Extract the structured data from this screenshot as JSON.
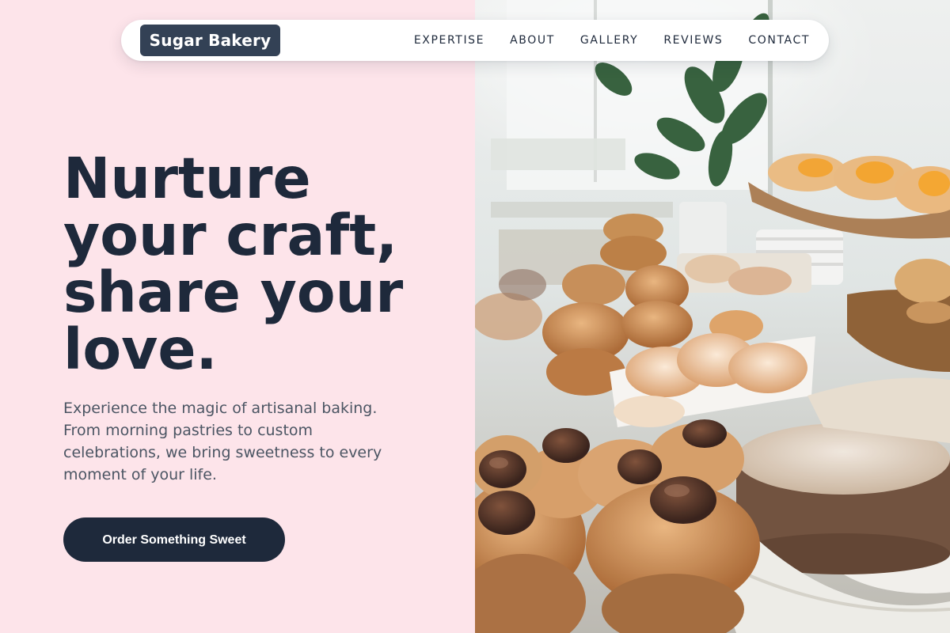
{
  "navbar": {
    "logo": "Sugar Bakery",
    "links": [
      "EXPERTISE",
      "ABOUT",
      "GALLERY",
      "REVIEWS",
      "CONTACT"
    ]
  },
  "hero": {
    "title_lines": [
      "Nurture",
      "your craft,",
      "share your",
      "love."
    ],
    "text_lines": [
      "Experience the magic of artisanal baking.",
      "From morning pastries to custom",
      "celebrations, we bring sweetness to every",
      "moment of your life."
    ],
    "cta_label": "Order Something Sweet"
  },
  "colors": {
    "left_background": "#fde4ea",
    "dark_navy": "#1e293b",
    "logo_background": "#334155",
    "body_text": "#4b5563"
  }
}
